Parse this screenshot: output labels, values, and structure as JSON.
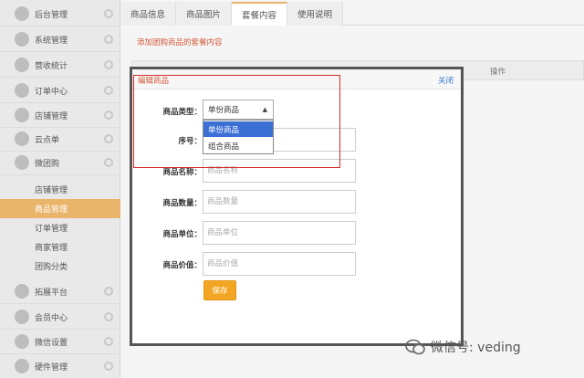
{
  "sidebar": {
    "items": [
      {
        "label": "后台管理",
        "icon": "home-icon"
      },
      {
        "label": "系统管理",
        "icon": "system-icon"
      },
      {
        "label": "营收统计",
        "icon": "chart-icon"
      },
      {
        "label": "订单中心",
        "icon": "order-icon"
      },
      {
        "label": "店铺管理",
        "icon": "store-icon"
      },
      {
        "label": "云点单",
        "icon": "cloud-icon"
      },
      {
        "label": "微团购",
        "icon": "group-icon"
      }
    ],
    "sub_items": [
      {
        "label": "店铺管理",
        "active": false
      },
      {
        "label": "商品管理",
        "active": true
      },
      {
        "label": "订单管理",
        "active": false
      },
      {
        "label": "商家管理",
        "active": false
      },
      {
        "label": "团购分类",
        "active": false
      }
    ],
    "bottom_items": [
      {
        "label": "拓展平台",
        "icon": "expand-icon"
      },
      {
        "label": "会员中心",
        "icon": "member-icon"
      },
      {
        "label": "微信设置",
        "icon": "wechat-icon"
      },
      {
        "label": "硬件管理",
        "icon": "hardware-icon"
      }
    ]
  },
  "tabs": [
    {
      "label": "商品信息",
      "active": false
    },
    {
      "label": "商品图片",
      "active": false
    },
    {
      "label": "套餐内容",
      "active": true
    },
    {
      "label": "使用说明",
      "active": false
    }
  ],
  "hint": "添加团购商品的套餐内容",
  "table": {
    "op_header": "操作"
  },
  "modal": {
    "title": "编辑商品",
    "close_label": "关闭",
    "fields": {
      "type_label": "商品类型：",
      "type_value": "单份商品",
      "type_options": [
        "单份商品",
        "组合商品"
      ],
      "seq_label": "序号：",
      "name_label": "商品名称：",
      "name_placeholder": "商品名称",
      "qty_label": "商品数量：",
      "qty_placeholder": "商品数量",
      "unit_label": "商品单位：",
      "unit_placeholder": "商品单位",
      "price_label": "商品价值：",
      "price_placeholder": "商品价值"
    },
    "save_label": "保存"
  },
  "watermark": "微信号: veding",
  "colors": {
    "accent": "#e8b56a",
    "save": "#f2a623",
    "selected_option": "#3b6fd4",
    "annotation": "#d62b2b",
    "hint": "#d25a3a"
  }
}
